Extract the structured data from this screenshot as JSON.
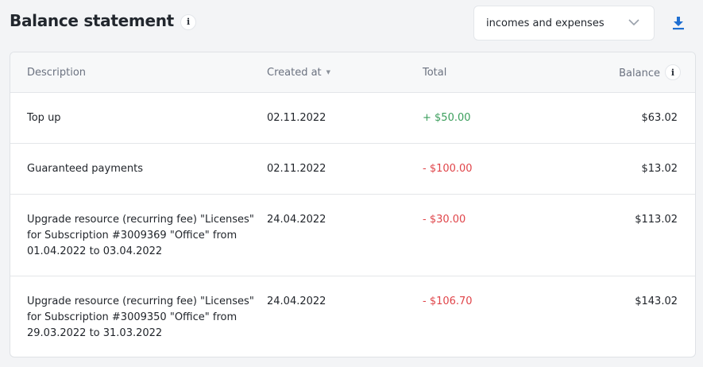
{
  "page": {
    "title": "Balance statement",
    "info_glyph": "i"
  },
  "filter": {
    "selected": "incomes and expenses"
  },
  "icons": {
    "download": "download-icon",
    "chevron": "chevron-down-icon",
    "info": "info-icon"
  },
  "colors": {
    "positive": "#3b9e5c",
    "negative": "#e0454a",
    "accent": "#1f6fd1"
  },
  "table": {
    "headers": {
      "description": "Description",
      "created_at": "Created at",
      "total": "Total",
      "balance": "Balance"
    },
    "rows": [
      {
        "description": "Top up",
        "created_at": "02.11.2022",
        "total": "+ $50.00",
        "balance": "$63.02"
      },
      {
        "description": "Guaranteed payments",
        "created_at": "02.11.2022",
        "total": "- $100.00",
        "balance": "$13.02"
      },
      {
        "description": "Upgrade resource (recurring fee) \"Licenses\" for Subscription #3009369 \"Office\" from 01.04.2022 to 03.04.2022",
        "created_at": "24.04.2022",
        "total": "- $30.00",
        "balance": "$113.02"
      },
      {
        "description": "Upgrade resource (recurring fee) \"Licenses\" for Subscription #3009350 \"Office\" from 29.03.2022 to 31.03.2022",
        "created_at": "24.04.2022",
        "total": "- $106.70",
        "balance": "$143.02"
      }
    ]
  }
}
